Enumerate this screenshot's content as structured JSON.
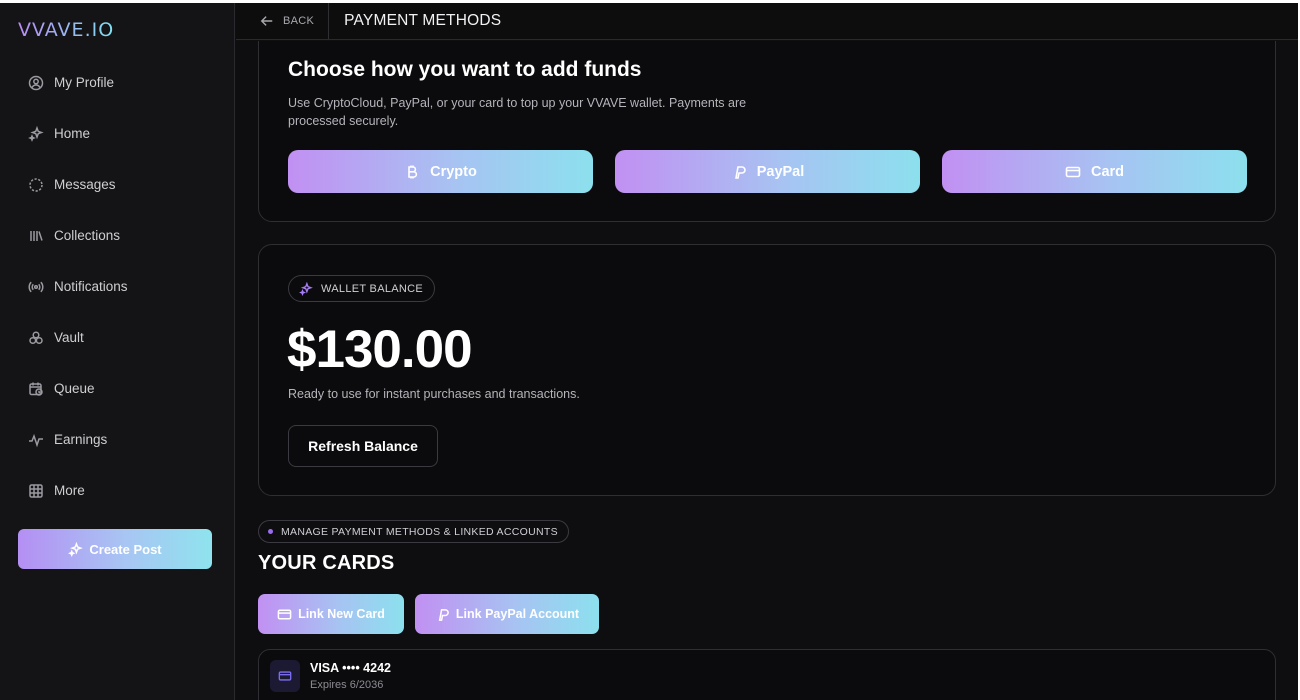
{
  "app": {
    "logo": "VVAVE.IO"
  },
  "sidebar": {
    "items": [
      {
        "label": "My Profile",
        "icon": "user-circle-icon"
      },
      {
        "label": "Home",
        "icon": "sparkles-icon"
      },
      {
        "label": "Messages",
        "icon": "message-circle-icon"
      },
      {
        "label": "Collections",
        "icon": "library-icon"
      },
      {
        "label": "Notifications",
        "icon": "broadcast-icon"
      },
      {
        "label": "Vault",
        "icon": "vault-circles-icon"
      },
      {
        "label": "Queue",
        "icon": "calendar-clock-icon"
      },
      {
        "label": "Earnings",
        "icon": "pulse-icon"
      },
      {
        "label": "More",
        "icon": "grid-icon"
      }
    ],
    "create_post": "Create Post"
  },
  "header": {
    "back": "BACK",
    "title": "PAYMENT METHODS"
  },
  "funds": {
    "title": "Choose how you want to add funds",
    "description": "Use CryptoCloud, PayPal, or your card to top up your VVAVE wallet. Payments are processed securely.",
    "buttons": {
      "crypto": "Crypto",
      "paypal": "PayPal",
      "card": "Card"
    }
  },
  "wallet": {
    "badge": "WALLET BALANCE",
    "balance": "$130.00",
    "description": "Ready to use for instant purchases and transactions.",
    "refresh": "Refresh Balance"
  },
  "cards": {
    "badge": "MANAGE PAYMENT METHODS & LINKED ACCOUNTS",
    "title": "YOUR CARDS",
    "link_card": "Link New Card",
    "link_paypal": "Link PayPal Account",
    "list": [
      {
        "name": "VISA •••• 4242",
        "expires": "Expires 6/2036"
      }
    ]
  },
  "colors": {
    "accent_start": "#c190f2",
    "accent_end": "#8ce0ee",
    "background": "#0e0e10"
  }
}
